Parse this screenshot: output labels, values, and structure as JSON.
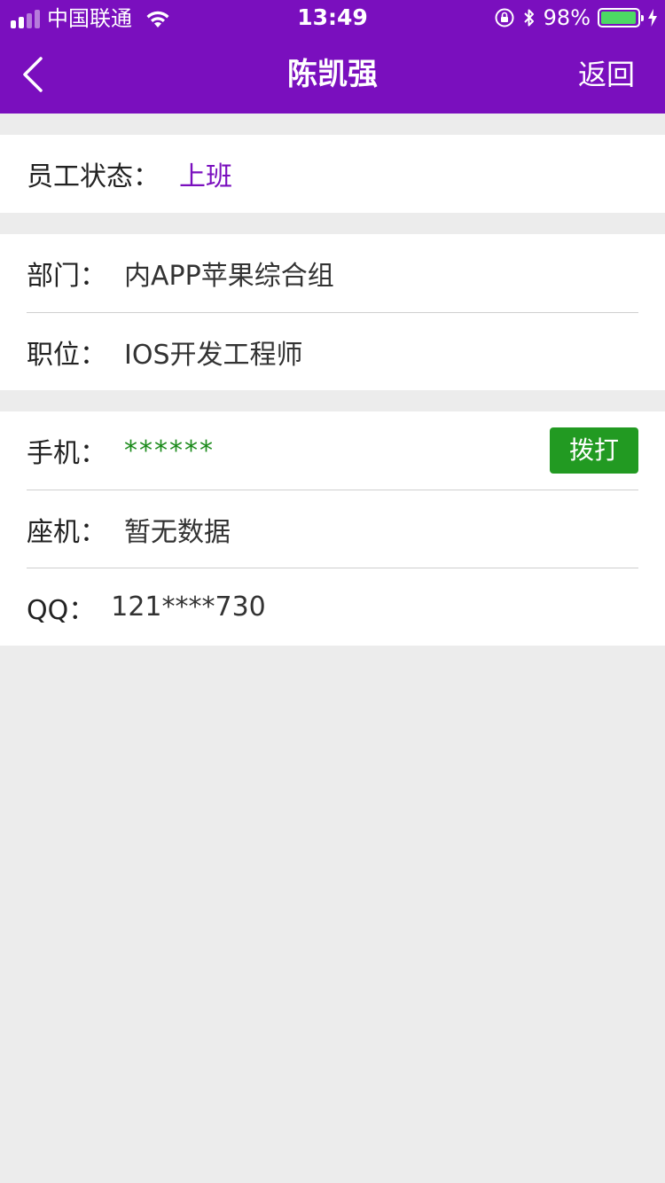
{
  "status_bar": {
    "carrier": "中国联通",
    "time": "13:49",
    "battery_pct": "98%",
    "battery_level": 0.98
  },
  "nav": {
    "title": "陈凯强",
    "back_label": "返回"
  },
  "status_section": {
    "label": "员工状态：",
    "value": "上班"
  },
  "job_section": {
    "dept_label": "部门：",
    "dept_value": "内APP苹果综合组",
    "position_label": "职位：",
    "position_value": "IOS开发工程师"
  },
  "contact_section": {
    "mobile_label": "手机：",
    "mobile_value": "******",
    "call_label": "拨打",
    "landline_label": "座机：",
    "landline_value": "暂无数据",
    "qq_label": "QQ：",
    "qq_value": "121****730"
  },
  "colors": {
    "brand": "#7a0fbe",
    "call_button": "#229a22",
    "phone_text": "#1c8b1c",
    "background": "#ececec"
  }
}
